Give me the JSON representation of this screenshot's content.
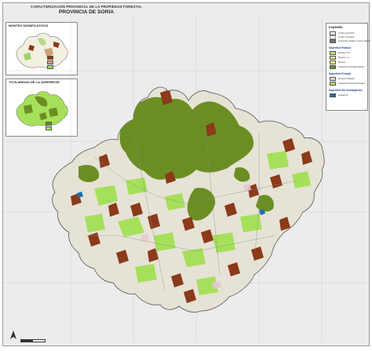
{
  "map": {
    "title": "CARACTERIZACIÓN PROVINCIAL DE LA PROPIEDAD FORESTAL",
    "subtitle": "PROVINCIA DE SORIA"
  },
  "insets": [
    {
      "title": "MONTES SIGNIFICATIVOS"
    },
    {
      "title": "TITULARIDAD DE LA SUPERFICIE"
    }
  ],
  "legend": {
    "title": "Leyenda",
    "boundaries": [
      {
        "label": "Límite provincial",
        "color": "#555555"
      },
      {
        "label": "Límite municipal",
        "color": "#999999"
      },
      {
        "label": "Superficie estatal / monte público",
        "color": "#777777"
      }
    ],
    "sections": [
      {
        "title": "Superficie Pública",
        "items": [
          {
            "label": "Montes U.P.",
            "color": "#c8d68a"
          },
          {
            "label": "Montes L.C.",
            "color": "#e2e08a"
          },
          {
            "label": "Montes",
            "color": "#f3ef9a"
          },
          {
            "label": "Superficie Forestal Pública",
            "color": "#6b8e23"
          }
        ]
      },
      {
        "title": "Superficie Privada",
        "items": [
          {
            "label": "Montes Privados",
            "color": "#f0d7c0"
          },
          {
            "label": "Superficie Forestal Privada",
            "color": "#a6e05a"
          }
        ]
      },
      {
        "title": "Superficie Sin Investigación",
        "items": [
          {
            "label": "Superficie",
            "color": "#1f6fb5"
          }
        ]
      }
    ]
  },
  "colors": {
    "public_forest": "#6b8e23",
    "private_forest": "#a6e05a",
    "brown_patches": "#8b3a1a",
    "background_land": "#e6e3d6",
    "water": "#1f6fb5"
  }
}
